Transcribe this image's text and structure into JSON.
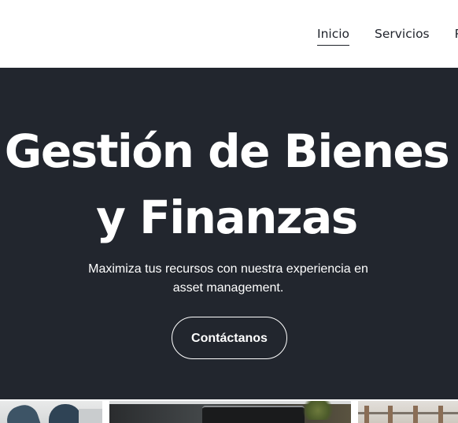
{
  "nav": {
    "items": [
      {
        "label": "Inicio",
        "active": true
      },
      {
        "label": "Servicios",
        "active": false
      },
      {
        "label": "P",
        "active": false
      }
    ]
  },
  "hero": {
    "title": "Gestión de Bienes y Finanzas",
    "subtitle": "Maximiza tus recursos con nuestra experiencia en asset management.",
    "cta_label": "Contáctanos",
    "background": "#22262e"
  },
  "colors": {
    "text_dark": "#1f232b",
    "text_light": "#ffffff"
  }
}
